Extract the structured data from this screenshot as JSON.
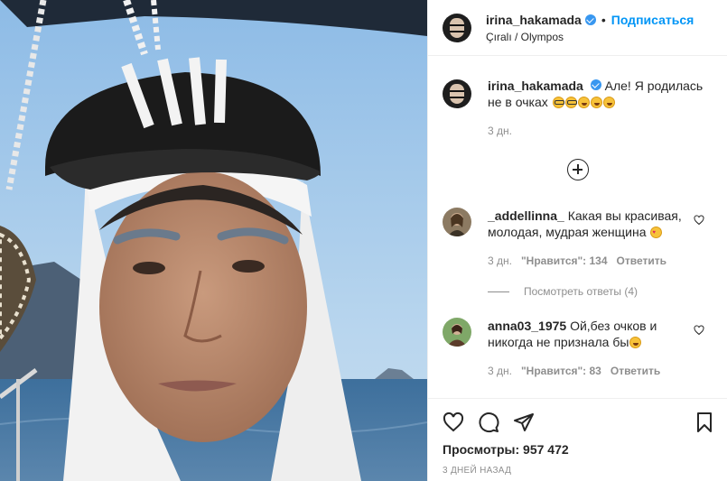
{
  "post": {
    "username": "irina_hakamada",
    "follow_label": "Подписаться",
    "separator": "•",
    "location": "Çıralı / Olympos"
  },
  "caption": {
    "username": "irina_hakamada",
    "text": "Але! Я родилась не в очках",
    "emojis": [
      "glasses-emoji",
      "glasses-emoji",
      "laughing-emoji",
      "laughing-emoji",
      "laughing-emoji"
    ],
    "time": "3 дн."
  },
  "comments": [
    {
      "username": "_addellinna_",
      "text": "Какая вы красивая, молодая, мудрая женщина",
      "emoji": "heart-eyes-emoji",
      "time": "3 дн.",
      "likes": "\"Нравится\": 134",
      "reply_label": "Ответить",
      "view_replies": "Посмотреть ответы (4)"
    },
    {
      "username": "anna03_1975",
      "text": "Ой,без очков и никогда не признала бы",
      "emoji": "laughing-emoji",
      "time": "3 дн.",
      "likes": "\"Нравится\": 83",
      "reply_label": "Ответить"
    }
  ],
  "stats": {
    "views": "Просмотры: 957 472",
    "date": "3 ДНЕЙ НАЗАД"
  },
  "icons": {
    "like": "heart-icon",
    "comment": "comment-icon",
    "share": "share-icon",
    "save": "bookmark-icon",
    "load_more": "plus-circle-icon"
  },
  "colors": {
    "accent": "#0095f6",
    "verified": "#3897f0",
    "muted": "#8e8e8e",
    "text": "#262626"
  }
}
